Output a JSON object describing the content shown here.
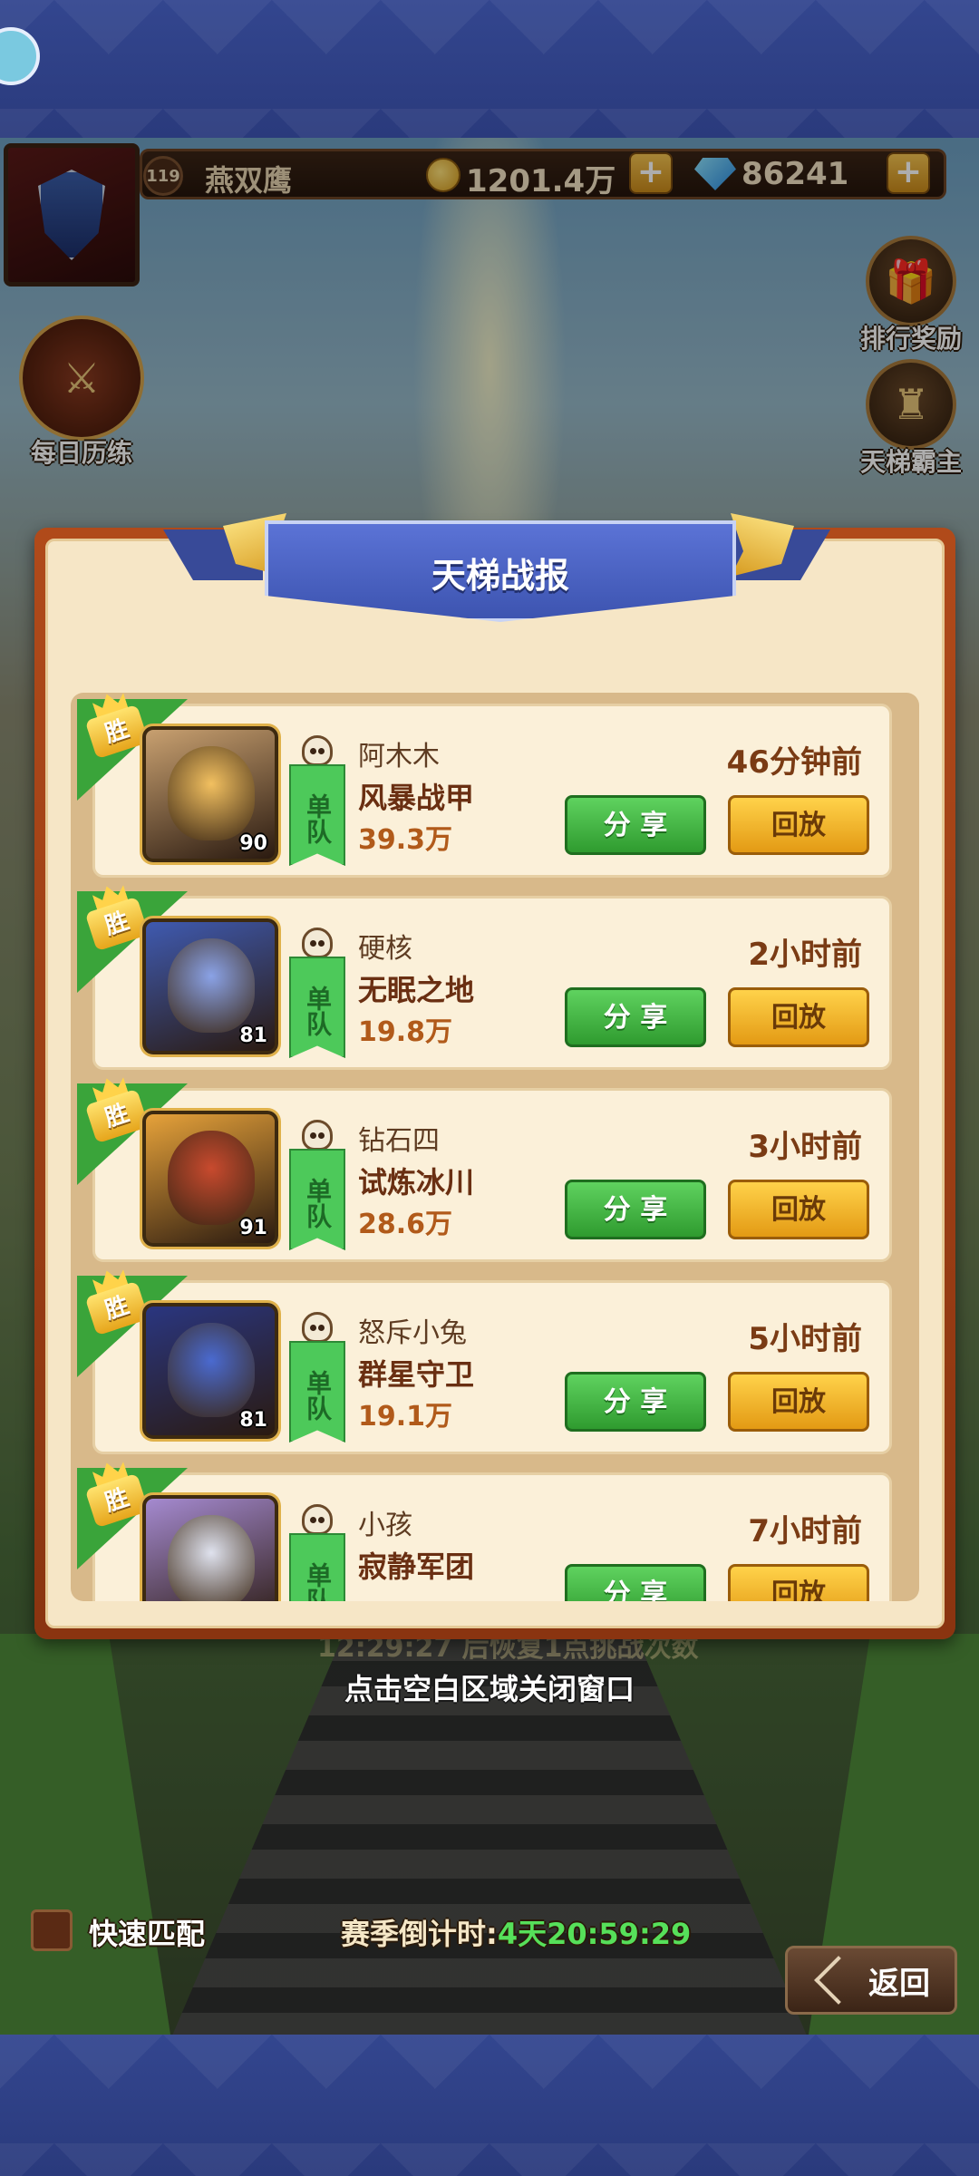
{
  "header": {
    "player_level": "119",
    "player_name": "燕双鹰",
    "coins": "1201.4万",
    "diamonds": "86241",
    "plus_label": "+"
  },
  "side_buttons": {
    "daily": "每日历练",
    "rank_reward": "排行奖励",
    "ladder_lord": "天梯霸主"
  },
  "modal": {
    "title": "天梯战报",
    "win_label": "胜",
    "solo_label": "单队",
    "share_label": "分 享",
    "replay_label": "回放",
    "records": [
      {
        "opponent": "阿木木",
        "map": "风暴战甲",
        "power": "39.3万",
        "time": "46分钟前",
        "hero_level": "90",
        "hero_color": "#f2c060",
        "bg": "#c8a070"
      },
      {
        "opponent": "硬核",
        "map": "无眠之地",
        "power": "19.8万",
        "time": "2小时前",
        "hero_level": "81",
        "hero_color": "#8aa2e6",
        "bg": "#3f5ab0"
      },
      {
        "opponent": "钻石四",
        "map": "试炼冰川",
        "power": "28.6万",
        "time": "3小时前",
        "hero_level": "91",
        "hero_color": "#c84a2e",
        "bg": "#e6a23a"
      },
      {
        "opponent": "怒斥小兔",
        "map": "群星守卫",
        "power": "19.1万",
        "time": "5小时前",
        "hero_level": "81",
        "hero_color": "#4a6ad0",
        "bg": "#2a3680"
      },
      {
        "opponent": "小孩",
        "map": "寂静军团",
        "power": "",
        "time": "7小时前",
        "hero_level": "",
        "hero_color": "#dfe2ee",
        "bg": "#a58ad0"
      }
    ]
  },
  "hint_behind": "12:29:27 后恢复1点挑战次数",
  "close_hint": "点击空白区域关闭窗口",
  "footer": {
    "quick_match": "快速匹配",
    "season_label": "赛季倒计时:",
    "season_value": "4天20:59:29",
    "back": "返回"
  }
}
